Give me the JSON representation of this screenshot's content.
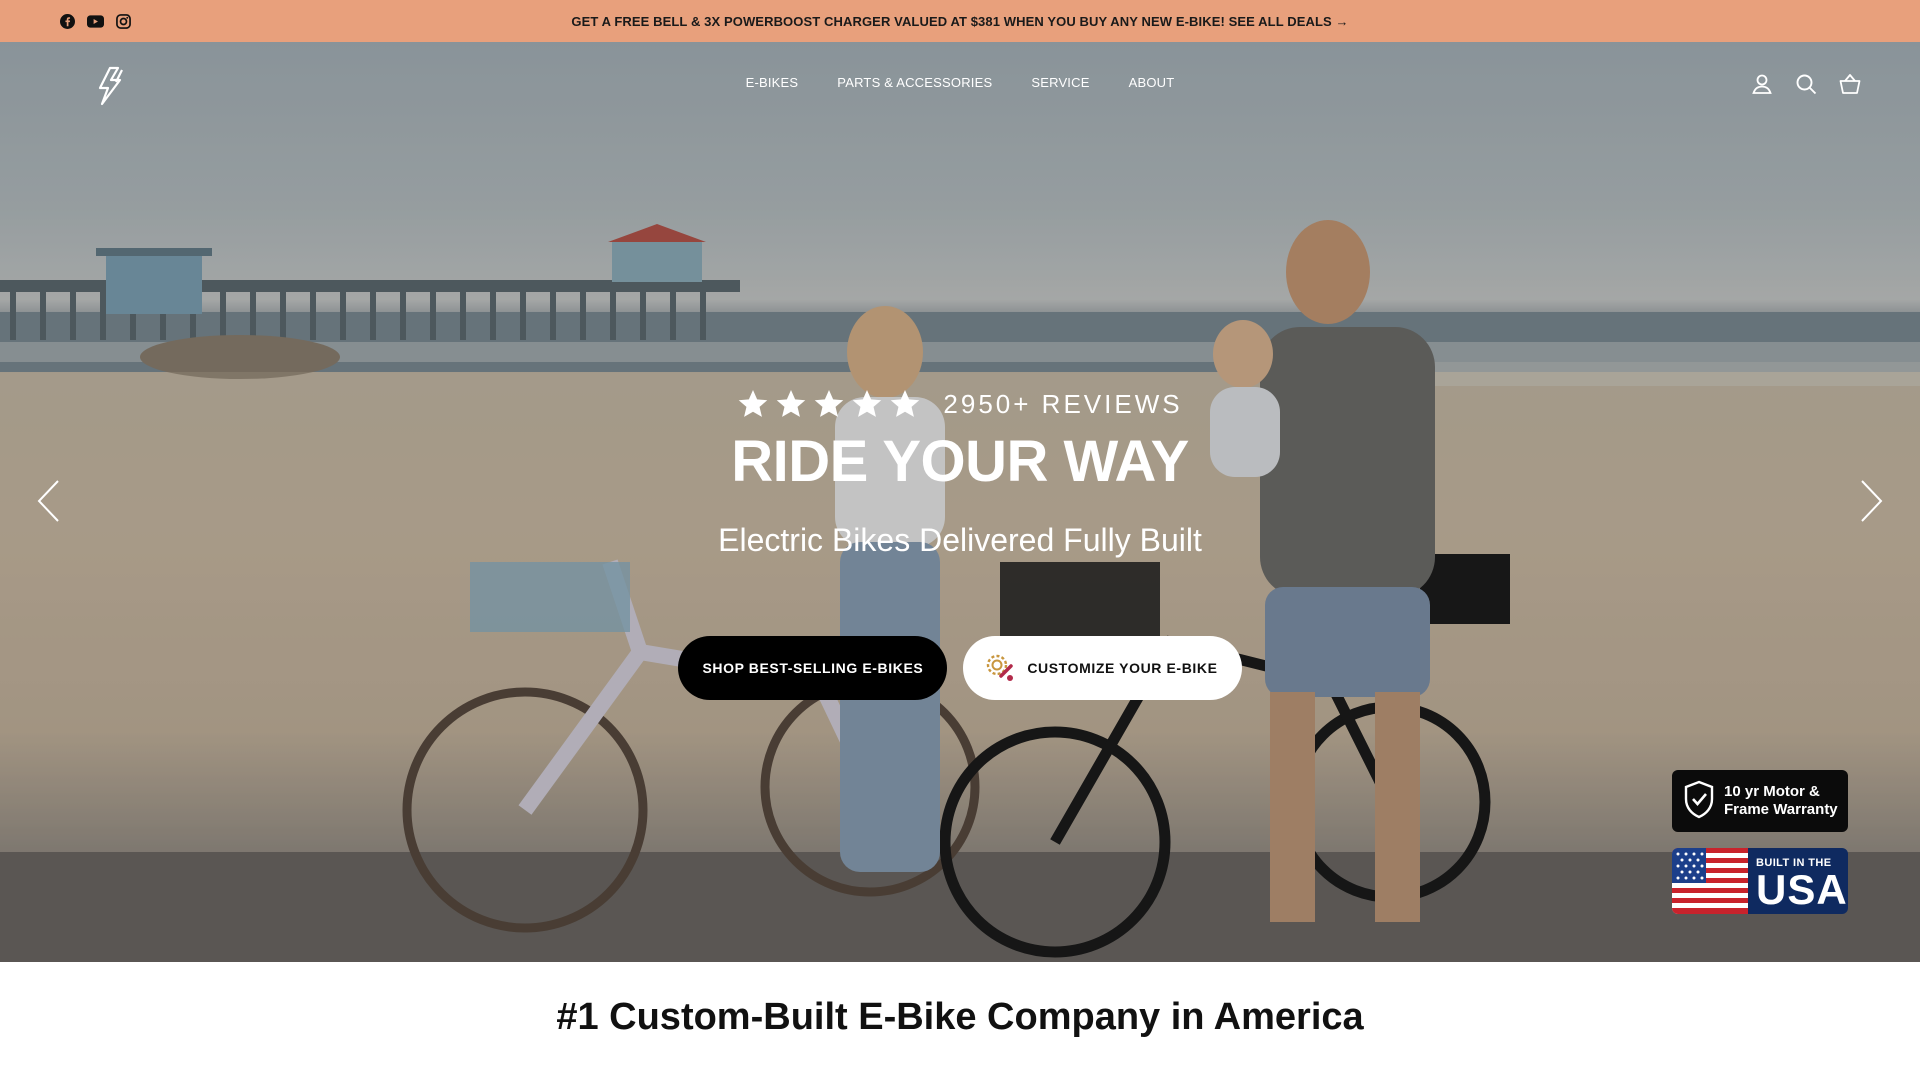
{
  "announcement": {
    "text": "GET A FREE BELL & 3X POWERBOOST CHARGER VALUED AT $381 WHEN YOU BUY ANY NEW E-BIKE! SEE ALL DEALS →",
    "background": "#e8a07c"
  },
  "social": {
    "icons": [
      "facebook-icon",
      "youtube-icon",
      "instagram-icon"
    ]
  },
  "header": {
    "logo_icon": "lightning-logo-icon",
    "nav": [
      "E-BIKES",
      "PARTS & ACCESSORIES",
      "SERVICE",
      "ABOUT"
    ],
    "icons": [
      "account-icon",
      "search-icon",
      "cart-icon"
    ]
  },
  "hero": {
    "rating_stars": 5,
    "reviews_label": "2950+ REVIEWS",
    "headline": "RIDE YOUR WAY",
    "subheadline": "Electric Bikes Delivered Fully Built",
    "primary_cta": "SHOP BEST-SELLING E-BIKES",
    "secondary_cta": "CUSTOMIZE YOUR E-BIKE",
    "secondary_cta_icon": "gear-customize-icon",
    "prev_icon": "chevron-left-icon",
    "next_icon": "chevron-right-icon"
  },
  "badges": {
    "warranty_line1": "10 yr Motor &",
    "warranty_line2": "Frame Warranty",
    "warranty_icon": "shield-check-icon",
    "usa_small": "BUILT IN THE",
    "usa_big": "USA"
  },
  "section": {
    "title": "#1 Custom-Built E-Bike Company in America"
  },
  "colors": {
    "accent": "#e8a07c",
    "dark_button": "#000000",
    "usa_badge": "#0f2a60"
  }
}
